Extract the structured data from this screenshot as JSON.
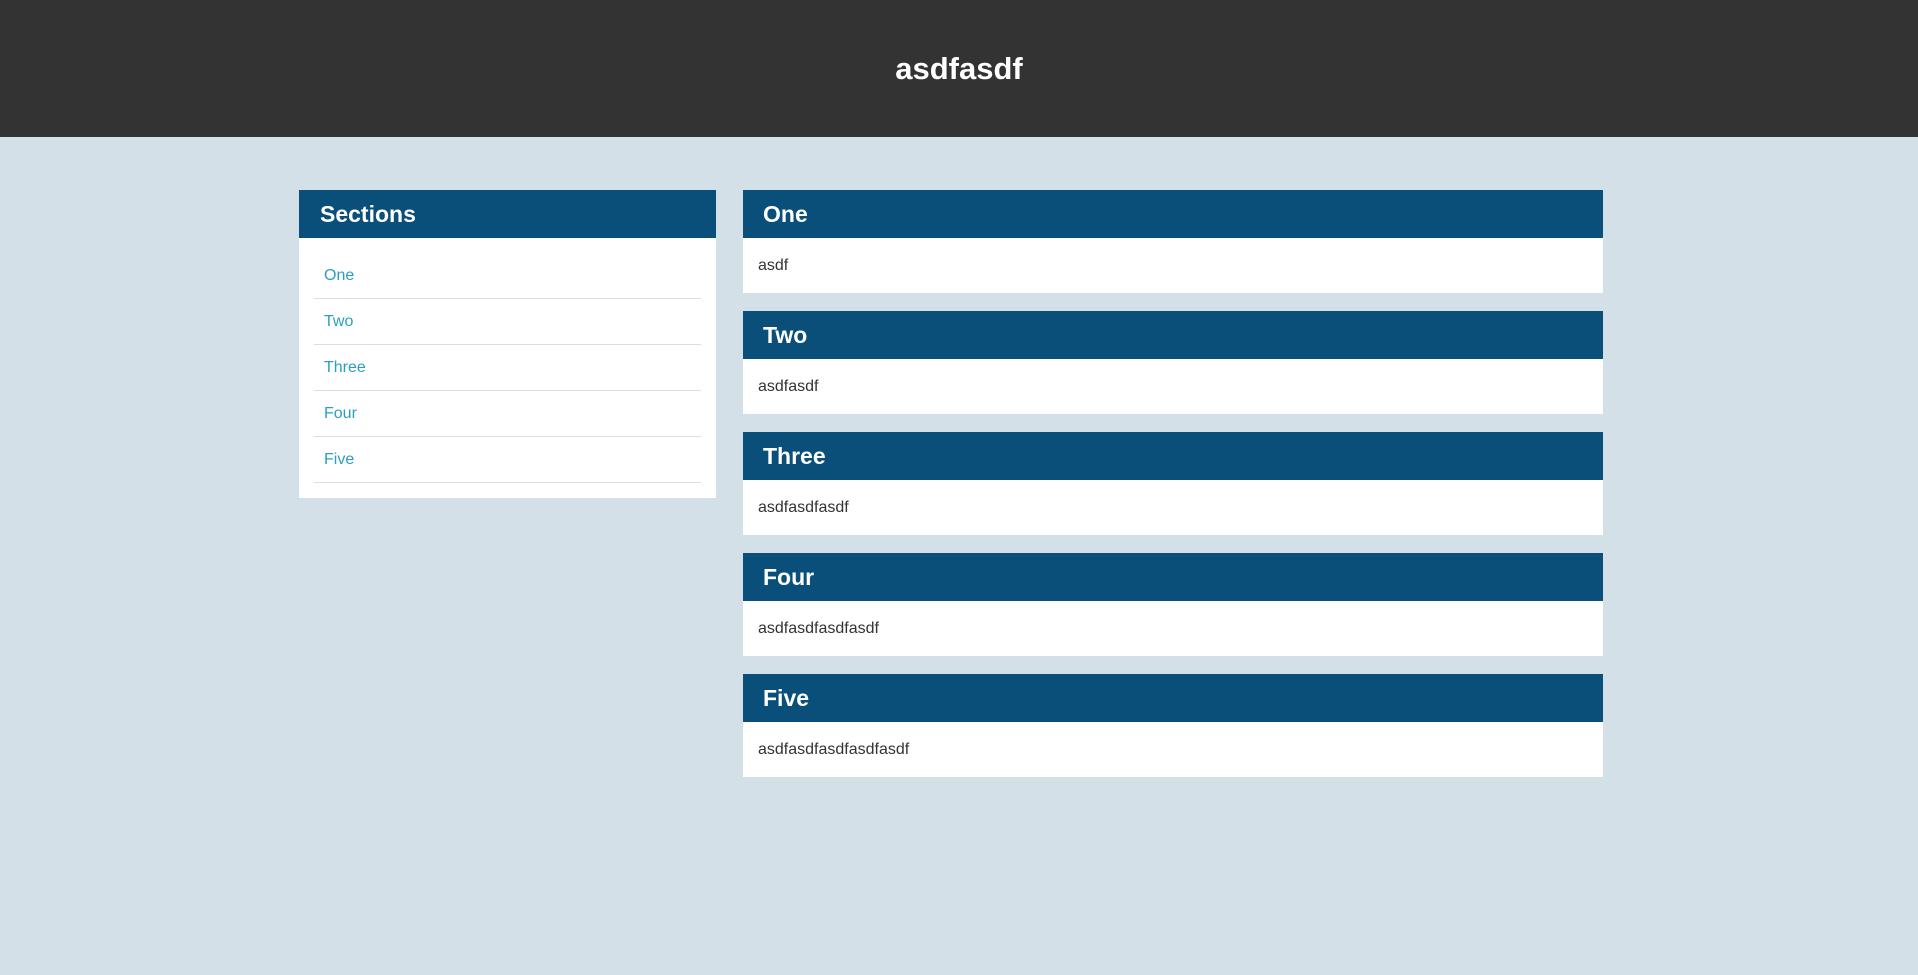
{
  "header": {
    "title": "asdfasdf"
  },
  "sidebar": {
    "title": "Sections",
    "items": [
      {
        "label": "One"
      },
      {
        "label": "Two"
      },
      {
        "label": "Three"
      },
      {
        "label": "Four"
      },
      {
        "label": "Five"
      }
    ]
  },
  "sections": [
    {
      "title": "One",
      "body": "asdf"
    },
    {
      "title": "Two",
      "body": "asdfasdf"
    },
    {
      "title": "Three",
      "body": "asdfasdfasdf"
    },
    {
      "title": "Four",
      "body": "asdfasdfasdfasdf"
    },
    {
      "title": "Five",
      "body": "asdfasdfasdfasdfasdf"
    }
  ],
  "colors": {
    "topbar": "#333333",
    "page_background": "#d3e0e8",
    "panel_header": "#0a4f79",
    "link": "#2a9fc1"
  }
}
